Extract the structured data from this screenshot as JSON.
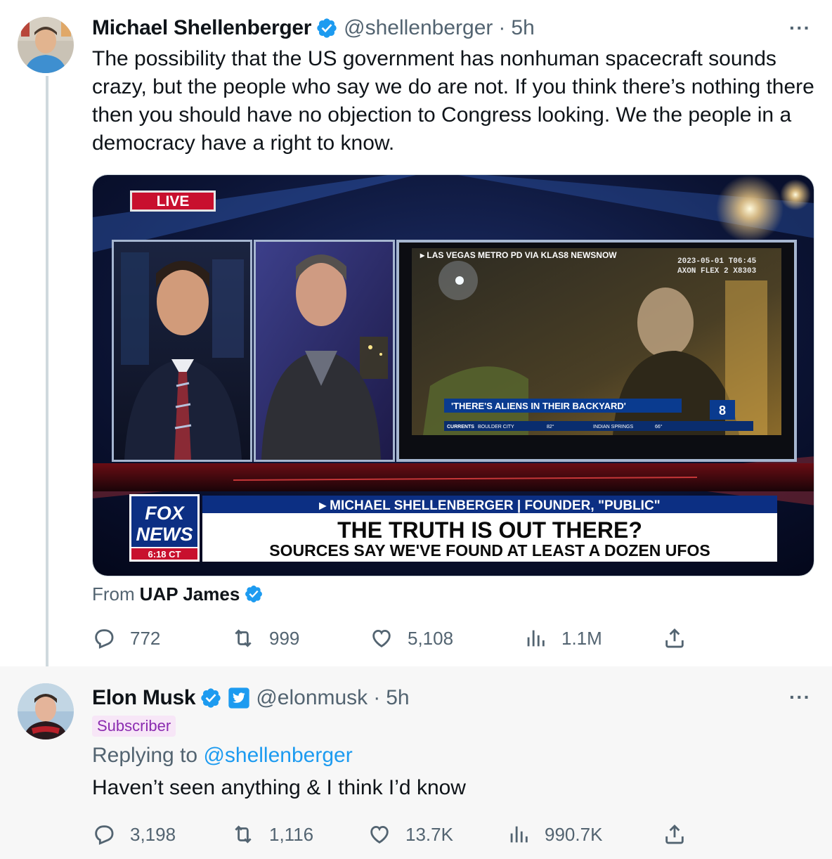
{
  "tweet1": {
    "display_name": "Michael Shellenberger",
    "handle": "@shellenberger",
    "separator": "·",
    "time": "5h",
    "more": "···",
    "text": "The possibility that the US government has nonhuman spacecraft sounds crazy, but the people who say we do are not. If you think there’s nothing there then you should have no objection to Congress looking. We the people in a democracy have a right to know.",
    "media": {
      "live_label": "LIVE",
      "video_source": "▸ LAS VEGAS METRO PD VIA KLAS8 NEWSNOW",
      "bodycam_line1": "2023-05-01 T06:45",
      "bodycam_line2": "AXON FLEX 2 X8303",
      "video_caption": "'THERE'S ALIENS IN THEIR BACKYARD'",
      "ticker_label": "CURRENTS",
      "ticker_city1": "BOULDER CITY",
      "ticker_temp1": "82°",
      "ticker_city2": "INDIAN SPRINGS",
      "ticker_temp2": "66°",
      "station_logo": "8",
      "network_top": "FOX",
      "network_bottom": "NEWS",
      "clock": "6:18 CT",
      "chyron_name": "▸ MICHAEL SHELLENBERGER | FOUNDER, \"PUBLIC\"",
      "chyron_headline": "THE TRUTH IS OUT THERE?",
      "chyron_sub": "SOURCES SAY WE'VE FOUND AT LEAST A DOZEN UFOS"
    },
    "from_prefix": "From",
    "from_name": "UAP James",
    "stats": {
      "replies": "772",
      "retweets": "999",
      "likes": "5,108",
      "views": "1.1M"
    }
  },
  "tweet2": {
    "display_name": "Elon Musk",
    "handle": "@elonmusk",
    "separator": "·",
    "time": "5h",
    "more": "···",
    "badge": "Subscriber",
    "replying_prefix": "Replying to",
    "replying_to": "@shellenberger",
    "text": "Haven’t seen anything & I think I’d know",
    "stats": {
      "replies": "3,198",
      "retweets": "1,116",
      "likes": "13.7K",
      "views": "990.7K"
    }
  },
  "colors": {
    "verified_blue": "#1d9bf0",
    "text_primary": "#0f1419",
    "text_secondary": "#536471",
    "subscriber_bg": "#f7e6f7",
    "subscriber_text": "#8b2bb0",
    "fox_blue": "#0c2f83",
    "live_red": "#c8102e"
  },
  "icons": [
    "reply-icon",
    "retweet-icon",
    "like-icon",
    "views-icon",
    "share-icon",
    "verified-badge-icon",
    "affiliate-badge-icon",
    "more-icon"
  ]
}
